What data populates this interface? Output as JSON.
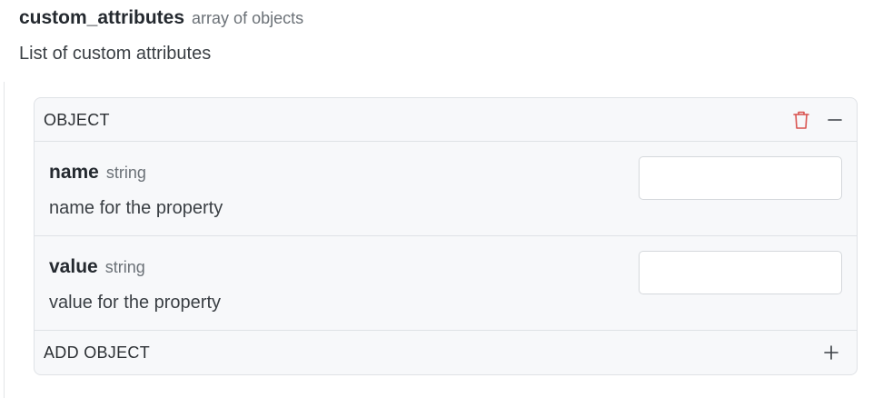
{
  "parameter": {
    "name": "custom_attributes",
    "type": "array of objects",
    "description": "List of custom attributes"
  },
  "object_card": {
    "header_label": "OBJECT",
    "delete_icon": "trash-icon",
    "collapse_icon": "minus-icon",
    "fields": [
      {
        "name": "name",
        "type": "string",
        "description": "name for the property",
        "value": "",
        "placeholder": ""
      },
      {
        "name": "value",
        "type": "string",
        "description": "value for the property",
        "value": "",
        "placeholder": ""
      }
    ],
    "add_label": "ADD OBJECT",
    "add_icon": "plus-icon"
  },
  "colors": {
    "delete": "#d9534f",
    "card_background": "#f7f8fa",
    "border": "#dfe2e6"
  }
}
